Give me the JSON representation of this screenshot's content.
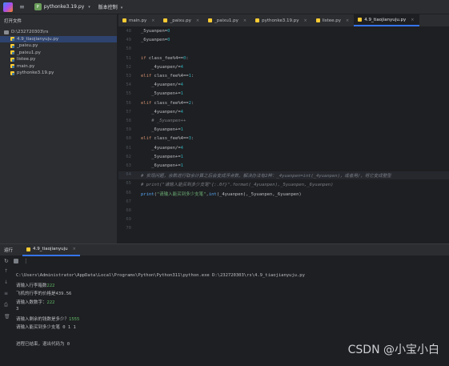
{
  "titlebar": {
    "project_name": "pythonke3.19.py",
    "vcs_label": "版本控制"
  },
  "sidebar": {
    "header": "打开文件",
    "items": [
      {
        "label": "D:\\232720303\\rs",
        "type": "folder",
        "indent": 0,
        "selected": false
      },
      {
        "label": "4.9_tiaojianyuju.py",
        "type": "py",
        "indent": 1,
        "selected": true
      },
      {
        "label": "_paixu.py",
        "type": "py",
        "indent": 1,
        "selected": false
      },
      {
        "label": "_paixu1.py",
        "type": "py",
        "indent": 1,
        "selected": false
      },
      {
        "label": "listee.py",
        "type": "py",
        "indent": 1,
        "selected": false
      },
      {
        "label": "main.py",
        "type": "py",
        "indent": 1,
        "selected": false
      },
      {
        "label": "pythonke3.19.py",
        "type": "py",
        "indent": 1,
        "selected": false
      }
    ]
  },
  "editor_tabs": [
    {
      "label": "main.py",
      "active": false
    },
    {
      "label": "_paixu.py",
      "active": false
    },
    {
      "label": "_paixu1.py",
      "active": false
    },
    {
      "label": "pythonke3.19.py",
      "active": false
    },
    {
      "label": "listee.py",
      "active": false
    },
    {
      "label": "4.9_tiaojianyuju.py",
      "active": true
    }
  ],
  "editor": {
    "highlight_line": 64,
    "lines": [
      {
        "n": "48",
        "html": "_5yuanpen=<span class='num'>0</span>"
      },
      {
        "n": "49",
        "html": "_6yuanpen=<span class='num'>0</span>"
      },
      {
        "n": "50",
        "html": ""
      },
      {
        "n": "51",
        "html": "<span class='kw'>if</span> class_fee%4==<span class='num'>0</span>:"
      },
      {
        "n": "52",
        "html": "    _4yuanpen/=<span class='num'>4</span>"
      },
      {
        "n": "53",
        "html": "<span class='kw'>elif</span> class_fee%4==<span class='num'>1</span>:"
      },
      {
        "n": "54",
        "html": "    _4yuanpen/=<span class='num'>4</span>"
      },
      {
        "n": "55",
        "html": "    _5yuanpen+=<span class='num'>1</span>"
      },
      {
        "n": "56",
        "html": "<span class='kw'>elif</span> class_fee%4==<span class='num'>2</span>:"
      },
      {
        "n": "57",
        "html": "    _4yuanpen/=<span class='num'>4</span>"
      },
      {
        "n": "58",
        "html": "    <span class='cm'># _5yuanpen++</span>"
      },
      {
        "n": "59",
        "html": "    _6yuanpen+=<span class='num'>1</span>"
      },
      {
        "n": "60",
        "html": "<span class='kw'>elif</span> class_fee%4==<span class='num'>3</span>:"
      },
      {
        "n": "61",
        "html": "    _4yuanpen/=<span class='num'>4</span>"
      },
      {
        "n": "62",
        "html": "    _5yuanpen+=<span class='num'>1</span>"
      },
      {
        "n": "63",
        "html": "    _6yuanpen+=<span class='num'>1</span>"
      },
      {
        "n": "64",
        "html": "<span class='cm'># 实现问题，余数进行取余计算之后会变成浮点数，解决办法有2种：_4yuanpen=int(_4yuanpen)，或者用/，将它变成整型</span>"
      },
      {
        "n": "65",
        "html": "<span class='cm'># print(\"请输入能买到多少支笔\"{:.0f}\".format(_4yuanpen),_5yuanpen,_6yuanpen)</span>"
      },
      {
        "n": "66",
        "html": "<span class='fn'>print</span>(<span class='str'>\"请输入能买到多少支笔\"</span>,<span class='fn'>int</span>(_4yuanpen),_5yuanpen,_6yuanpen)"
      },
      {
        "n": "67",
        "html": ""
      },
      {
        "n": "68",
        "html": ""
      },
      {
        "n": "69",
        "html": ""
      },
      {
        "n": "70",
        "html": ""
      }
    ]
  },
  "run": {
    "panel_label": "运行",
    "tab_label": "4.9_tiaojianyuju",
    "console": [
      {
        "text": "C:\\Users\\Administrator\\AppData\\Local\\Programs\\Python\\Python311\\python.exe D:\\232720303\\rs\\4.9_tiaojianyuju.py",
        "input": ""
      },
      {
        "text": "请输入行李箱数",
        "input": "222"
      },
      {
        "text": "飞机的行李的价格是439.56",
        "input": ""
      },
      {
        "text": "请输入数数字：",
        "input": "222"
      },
      {
        "text": "3",
        "input": ""
      },
      {
        "text": "请输入剩余的钱数是多少？",
        "input": "1555"
      },
      {
        "text": "请输入能买到多少支笔 0 1 1",
        "input": ""
      },
      {
        "text": "",
        "input": ""
      },
      {
        "text": "进程已结束，退出代码为 0",
        "input": ""
      }
    ]
  },
  "watermark": "CSDN @小宝小白"
}
